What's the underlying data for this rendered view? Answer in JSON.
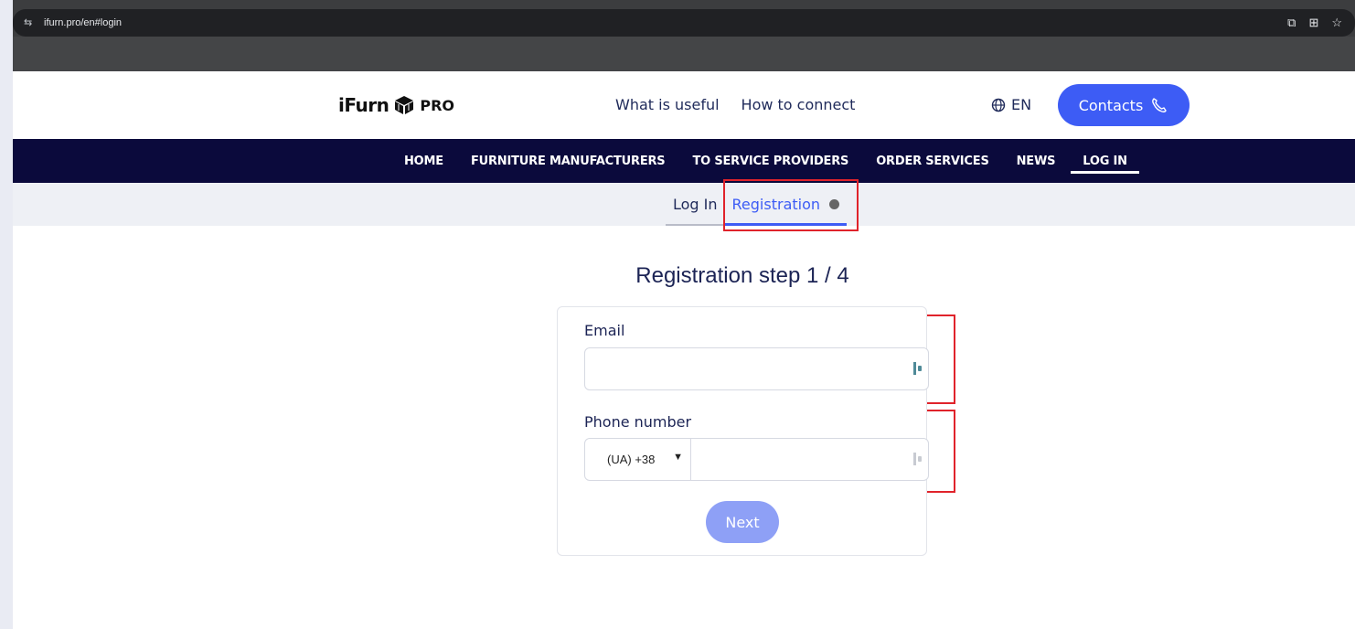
{
  "browser": {
    "url": "ifurn.pro/en#login",
    "actions": [
      "cast-icon",
      "translate-icon",
      "star-icon"
    ]
  },
  "header": {
    "logo_text": "iFurn",
    "logo_suffix": "PRO",
    "links": [
      "What is useful",
      "How to connect"
    ],
    "lang": "EN",
    "contacts_label": "Contacts"
  },
  "nav": {
    "items": [
      {
        "label": "HOME",
        "active": false
      },
      {
        "label": "FURNITURE MANUFACTURERS",
        "active": false
      },
      {
        "label": "TO SERVICE PROVIDERS",
        "active": false
      },
      {
        "label": "ORDER SERVICES",
        "active": false
      },
      {
        "label": "NEWS",
        "active": false
      },
      {
        "label": "LOG IN",
        "active": true
      }
    ]
  },
  "subtabs": {
    "login": "Log In",
    "registration": "Registration"
  },
  "form": {
    "title": "Registration step 1 / 4",
    "email_label": "Email",
    "email_value": "",
    "phone_label": "Phone number",
    "phone_code": "(UA) +38",
    "phone_value": "",
    "next_label": "Next"
  },
  "colors": {
    "accent": "#3d5cf5",
    "nav_bg": "#0b0a3c",
    "highlight": "#e0232b",
    "next_disabled": "#8ea0f6"
  }
}
